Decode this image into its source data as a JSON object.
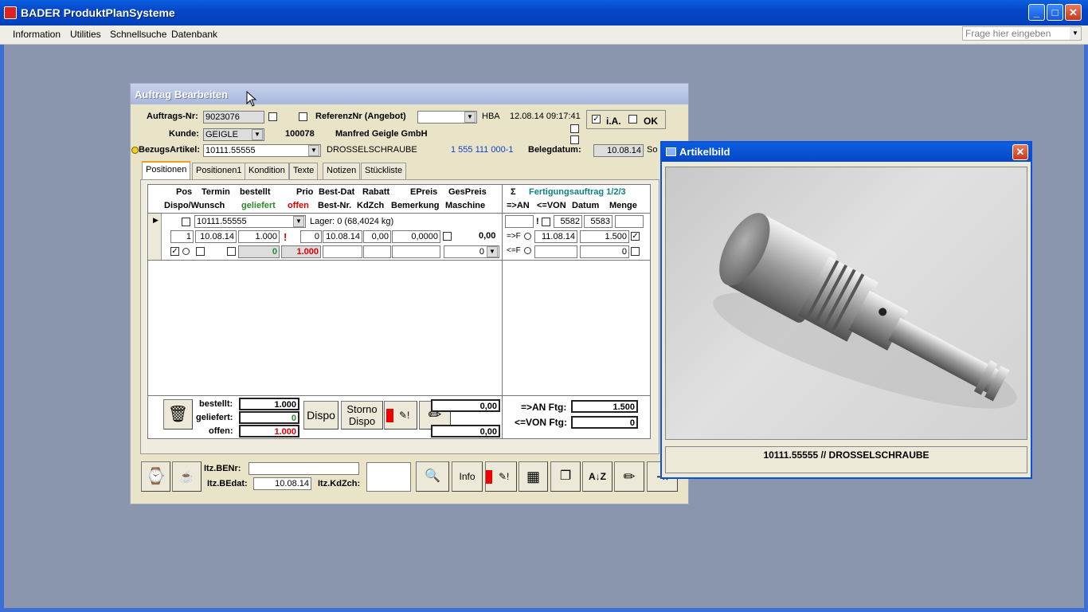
{
  "app": {
    "title": "BADER ProduktPlanSysteme"
  },
  "menu": [
    "Information",
    "Utilities",
    "Schnellsuche",
    "Datenbank"
  ],
  "search": {
    "placeholder": "Frage hier eingeben"
  },
  "auftrag": {
    "title": "Auftrag Bearbeiten",
    "auftrags_nr_label": "Auftrags-Nr:",
    "auftrags_nr": "9023076",
    "referenz_label": "ReferenzNr (Angebot)",
    "hba": "HBA",
    "timestamp": "12.08.14 09:17:41",
    "ia_label": "i.A.",
    "ok_label": "OK",
    "kunde_label": "Kunde:",
    "kunde": "GEIGLE",
    "kunde_nr": "100078",
    "kunde_name": "Manfred Geigle GmbH",
    "bezug_label": "BezugsArtikel:",
    "bezug": "10111.55555",
    "bezug_name": "DROSSELSCHRAUBE",
    "bezug_code": "1 555 111 000-1",
    "belegdatum_label": "Belegdatum:",
    "belegdatum": "10.08.14",
    "belegdatum_suffix": "So",
    "tabs": [
      "Positionen",
      "Positionen1",
      "Kondition",
      "Texte",
      "Notizen",
      "Stückliste"
    ],
    "headers1": {
      "pos": "Pos",
      "termin": "Termin",
      "bestellt": "bestellt",
      "prio": "Prio",
      "bestdat": "Best-Dat",
      "rabatt": "Rabatt",
      "epreis": "EPreis",
      "gespreis": "GesPreis",
      "sigma": "Σ",
      "fa": "Fertigungsauftrag 1/2/3"
    },
    "headers2": {
      "dispo": "Dispo/Wunsch",
      "geliefert": "geliefert",
      "offen": "offen",
      "bestnr": "Best-Nr.",
      "kdzch": "KdZch",
      "bemerkung": "Bemerkung",
      "maschine": "Maschine",
      "an": "=>AN",
      "von": "<=VON",
      "datum": "Datum",
      "menge": "Menge"
    },
    "row": {
      "artikel": "10111.55555",
      "lager": "Lager: 0  (68,4024 kg)",
      "fa1": "5582",
      "fa2": "5583",
      "pos": "1",
      "termin": "10.08.14",
      "bestellt": "1.000",
      "excl": "!",
      "prio": "0",
      "bestdat": "10.08.14",
      "rabatt": "0,00",
      "epreis": "0,0000",
      "gespreis": "0,00",
      "anf": "=>F",
      "an_datum": "11.08.14",
      "an_menge": "1.500",
      "geliefert": "0",
      "offen": "1.000",
      "maschine": "0",
      "vonf": "<=F",
      "von_menge": "0"
    },
    "summary": {
      "bestellt_label": "bestellt:",
      "bestellt": "1.000",
      "geliefert_label": "geliefert:",
      "geliefert": "0",
      "offen_label": "offen:",
      "offen": "1.000",
      "dispo": "Dispo",
      "storno": "Storno",
      "storno2": "Dispo",
      "sum1": "0,00",
      "sum2": "0,00",
      "an_ftg_label": "=>AN Ftg:",
      "an_ftg": "1.500",
      "von_ftg_label": "<=VON Ftg:",
      "von_ftg": "0"
    },
    "footer": {
      "benr_label": "Itz.BENr:",
      "bedat_label": "Itz.BEdat:",
      "bedat": "10.08.14",
      "kdzch_label": "Itz.KdZch:",
      "info": "Info"
    }
  },
  "artikel": {
    "title": "Artikelbild",
    "caption": "10111.55555  //  DROSSELSCHRAUBE"
  }
}
